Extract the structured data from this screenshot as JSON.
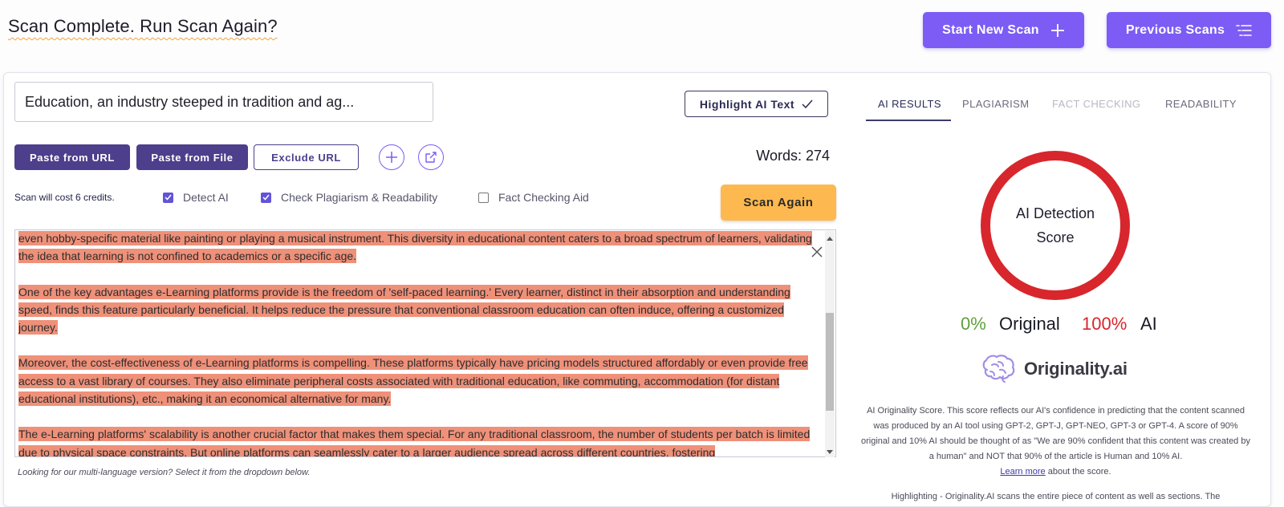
{
  "header": {
    "title": "Scan Complete. Run Scan Again?",
    "start_new_scan_label": "Start New Scan",
    "previous_scans_label": "Previous Scans"
  },
  "editor": {
    "document_title": "Education, an industry steeped in tradition and ag...",
    "highlight_label": "Highlight AI Text",
    "paste_url_label": "Paste from URL",
    "paste_file_label": "Paste from File",
    "exclude_url_label": "Exclude URL",
    "words_label": "Words: 274",
    "cost_text": "Scan will cost 6 credits.",
    "options": {
      "detect_ai": {
        "label": "Detect AI",
        "checked": true
      },
      "check_plagiarism": {
        "label": "Check Plagiarism & Readability",
        "checked": true
      },
      "fact_checking": {
        "label": "Fact Checking Aid",
        "checked": false
      }
    },
    "scan_again_label": "Scan Again",
    "paragraphs": [
      "even hobby-specific material like painting or playing a musical instrument. This diversity in educational content caters to a broad spectrum of learners, validating the idea that learning is not confined to academics or a specific age.",
      "One of the key advantages e-Learning platforms provide is the freedom of 'self-paced learning.' Every learner, distinct in their absorption and understanding speed, finds this feature particularly beneficial. It helps reduce the pressure that conventional classroom education can often induce, offering a customized journey.",
      "Moreover, the cost-effectiveness of e-Learning platforms is compelling. These platforms typically have pricing models structured affordably or even provide free access to a vast library of courses. They also eliminate peripheral costs associated with traditional education, like commuting, accommodation (for distant educational institutions), etc., making it an economical alternative for many.",
      "The e-Learning platforms' scalability is another crucial factor that makes them special. For any traditional classroom, the number of students per batch is limited due to physical space constraints. But online platforms can seamlessly cater to a larger audience spread across different countries, fostering"
    ],
    "multilang_note": "Looking for our multi-language version? Select it from the dropdown below."
  },
  "results": {
    "tabs": [
      {
        "label": "AI RESULTS",
        "state": "active"
      },
      {
        "label": "PLAGIARISM",
        "state": "normal"
      },
      {
        "label": "FACT CHECKING",
        "state": "disabled"
      },
      {
        "label": "READABILITY",
        "state": "normal"
      }
    ],
    "score_label": "AI Detection Score",
    "original_pct": "0%",
    "original_label": "Original",
    "ai_pct": "100%",
    "ai_label": "AI",
    "original_fraction": 0.0,
    "ai_fraction": 1.0,
    "brand_name": "Originality.ai",
    "description": "AI Originality Score. This score reflects our AI's confidence in predicting that the content scanned was produced by an AI tool using GPT-2, GPT-J, GPT-NEO, GPT-3 or GPT-4. A score of 90% original and 10% AI should be thought of as \"We are 90% confident that this content was created by a human\" and NOT that 90% of the article is Human and 10% AI.",
    "learn_more_label": "Learn more",
    "learn_more_suffix": " about the score.",
    "highlighting_text": "Highlighting - Originality.AI scans the entire piece of content as well as sections. The"
  },
  "colors": {
    "primary": "#7c5cf5",
    "dark_primary": "#4d3f8c",
    "scan_again": "#fdb94f",
    "ai_highlight": "#ef9079",
    "ai_red": "#d8262d",
    "original_green": "#5ea13b"
  },
  "icons": {
    "start_new_scan": "plus-icon",
    "previous_scans": "list-icon",
    "highlight": "check-icon",
    "add": "plus-circle-icon",
    "share": "share-icon",
    "close": "close-icon",
    "brand": "brain-logo-icon"
  }
}
